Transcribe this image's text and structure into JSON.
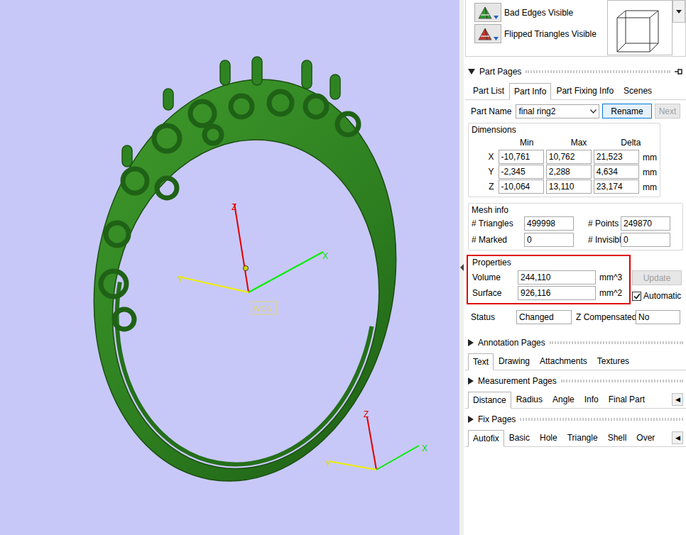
{
  "viewport": {
    "main_axes": {
      "z": "Z",
      "x": "X",
      "y": "Y",
      "frame": "WCS"
    },
    "corner_axes": {
      "z": "Z",
      "x": "X",
      "y": "Y"
    }
  },
  "display_toggles": [
    {
      "label": "Bad Edges Visible"
    },
    {
      "label": "Flipped Triangles Visible"
    }
  ],
  "part_pages": {
    "title": "Part Pages",
    "expanded": true,
    "tabs": [
      {
        "label": "Part List",
        "selected": false
      },
      {
        "label": "Part Info",
        "selected": true
      },
      {
        "label": "Part Fixing Info",
        "selected": false
      },
      {
        "label": "Scenes",
        "selected": false
      }
    ],
    "part_name": {
      "label": "Part Name",
      "value": "final ring2"
    },
    "buttons": [
      {
        "label": "Rename",
        "disabled": false
      },
      {
        "label": "Next",
        "disabled": true
      }
    ],
    "dimensions": {
      "title": "Dimensions",
      "columns": [
        "Min",
        "Max",
        "Delta"
      ],
      "unit": "mm",
      "rows": [
        {
          "axis": "X",
          "values": [
            "-10,761",
            "10,762",
            "21,523"
          ]
        },
        {
          "axis": "Y",
          "values": [
            "-2,345",
            "2,288",
            "4,634"
          ]
        },
        {
          "axis": "Z",
          "values": [
            "-10,064",
            "13,110",
            "23,174"
          ]
        }
      ]
    },
    "mesh_info": {
      "title": "Mesh info",
      "fields": [
        {
          "label": "# Triangles",
          "value": "499998"
        },
        {
          "label": "# Points",
          "value": "249870"
        },
        {
          "label": "# Marked",
          "value": "0"
        },
        {
          "label": "# Invisible",
          "value": "0"
        }
      ]
    },
    "properties": {
      "title": "Properties",
      "highlighted": true,
      "fields": [
        {
          "label": "Volume",
          "value": "244,110",
          "unit": "mm^3"
        },
        {
          "label": "Surface",
          "value": "926,116",
          "unit": "mm^2"
        }
      ],
      "update": {
        "label": "Update",
        "disabled": true
      },
      "automatic": {
        "label": "Automatic",
        "checked": true
      }
    },
    "status": [
      {
        "label": "Status",
        "value": "Changed"
      },
      {
        "label": "Z Compensated",
        "value": "No"
      }
    ]
  },
  "sections": [
    {
      "title": "Annotation Pages",
      "expanded": false,
      "tabs": [
        {
          "label": "Text",
          "selected": true
        },
        {
          "label": "Drawing",
          "selected": false
        },
        {
          "label": "Attachments",
          "selected": false
        },
        {
          "label": "Textures",
          "selected": false
        }
      ]
    },
    {
      "title": "Measurement Pages",
      "expanded": false,
      "scroll": "◀",
      "tabs": [
        {
          "label": "Distance",
          "selected": true
        },
        {
          "label": "Radius",
          "selected": false
        },
        {
          "label": "Angle",
          "selected": false
        },
        {
          "label": "Info",
          "selected": false
        },
        {
          "label": "Final Part",
          "selected": false
        }
      ]
    },
    {
      "title": "Fix Pages",
      "expanded": false,
      "scroll": "◀",
      "tabs": [
        {
          "label": "Autofix",
          "selected": true
        },
        {
          "label": "Basic",
          "selected": false
        },
        {
          "label": "Hole",
          "selected": false
        },
        {
          "label": "Triangle",
          "selected": false
        },
        {
          "label": "Shell",
          "selected": false
        },
        {
          "label": "Over",
          "selected": false
        }
      ]
    }
  ]
}
